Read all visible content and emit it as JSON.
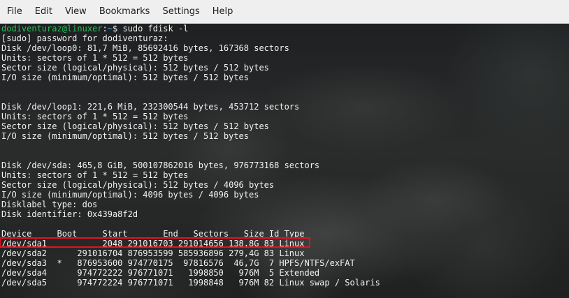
{
  "menubar": {
    "items": [
      "File",
      "Edit",
      "View",
      "Bookmarks",
      "Settings",
      "Help"
    ]
  },
  "terminal": {
    "prompt": {
      "user_host": "dodiventuraz@linuxer",
      "path": "~",
      "symbol": "$",
      "command": "sudo fdisk -l"
    },
    "lines": [
      "[sudo] password for dodiventuraz:",
      "Disk /dev/loop0: 81,7 MiB, 85692416 bytes, 167368 sectors",
      "Units: sectors of 1 * 512 = 512 bytes",
      "Sector size (logical/physical): 512 bytes / 512 bytes",
      "I/O size (minimum/optimal): 512 bytes / 512 bytes",
      "",
      "",
      "Disk /dev/loop1: 221,6 MiB, 232300544 bytes, 453712 sectors",
      "Units: sectors of 1 * 512 = 512 bytes",
      "Sector size (logical/physical): 512 bytes / 512 bytes",
      "I/O size (minimum/optimal): 512 bytes / 512 bytes",
      "",
      "",
      "Disk /dev/sda: 465,8 GiB, 500107862016 bytes, 976773168 sectors",
      "Units: sectors of 1 * 512 = 512 bytes",
      "Sector size (logical/physical): 512 bytes / 4096 bytes",
      "I/O size (minimum/optimal): 4096 bytes / 4096 bytes",
      "Disklabel type: dos",
      "Disk identifier: 0x439a8f2d",
      "",
      "Device     Boot     Start       End   Sectors   Size Id Type",
      "/dev/sda1           2048 291016703 291014656 138,8G 83 Linux",
      "/dev/sda2      291016704 876953599 585936896 279,4G 83 Linux",
      "/dev/sda3  *   876953600 974770175  97816576  46,7G  7 HPFS/NTFS/exFAT",
      "/dev/sda4      974772222 976771071   1998850   976M  5 Extended",
      "/dev/sda5      974772224 976771071   1998848   976M 82 Linux swap / Solaris"
    ],
    "highlighted_row": "/dev/sda1",
    "colors": {
      "user_host": "#27c25a",
      "path": "#3daee9",
      "text": "#f2f2f2",
      "highlight_border": "#e8101e"
    }
  }
}
